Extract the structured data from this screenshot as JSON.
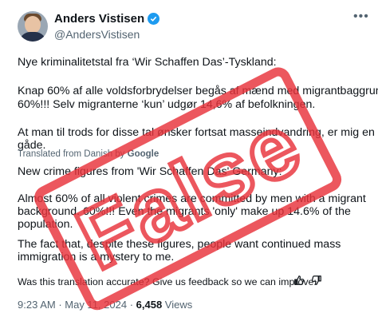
{
  "author": {
    "name": "Anders Vistisen",
    "handle": "@AndersVistisen"
  },
  "tweet": {
    "original_line1": "Nye kriminalitetstal fra ‘Wir Schaffen Das’-Tyskland:",
    "original_line2": "Knap 60% af alle voldsforbrydelser begås af mænd med migrantbaggrund.",
    "original_line3": "60%!!! Selv migranterne ‘kun’ udgør 14,6% af befolkningen.",
    "original_line4": "At man til trods for disse tal ønsker fortsat masseindvandring, er mig en",
    "original_line5": "gåde.",
    "translated_prefix": "Translated from Danish by ",
    "translated_brand": "Google",
    "translation_line1": "New crime figures from 'Wir Schaffen Das' Germany:",
    "translation_line2": "Almost 60% of all violent crimes are committed by men with a migrant",
    "translation_line3": "background. 60%!!! Even the migrants 'only' make up 14.6% of the",
    "translation_line4": "population.",
    "translation_line5": "The fact that, despite these figures, people want continued mass",
    "translation_line6": "immigration is a mystery to me."
  },
  "feedback": {
    "question": "Was this translation accurate? Give us feedback so we can improve:"
  },
  "meta": {
    "time": "9:23 AM",
    "separator": " · ",
    "date": "May 11, 2024",
    "views_count": "6,458",
    "views_label": " Views"
  },
  "stamp": {
    "text": "False",
    "color": "#e8333b"
  },
  "icons": {
    "verified": "verified-badge-icon",
    "more": "more-icon",
    "thumbs_up": "thumbs-up-icon",
    "thumbs_down": "thumbs-down-icon"
  }
}
